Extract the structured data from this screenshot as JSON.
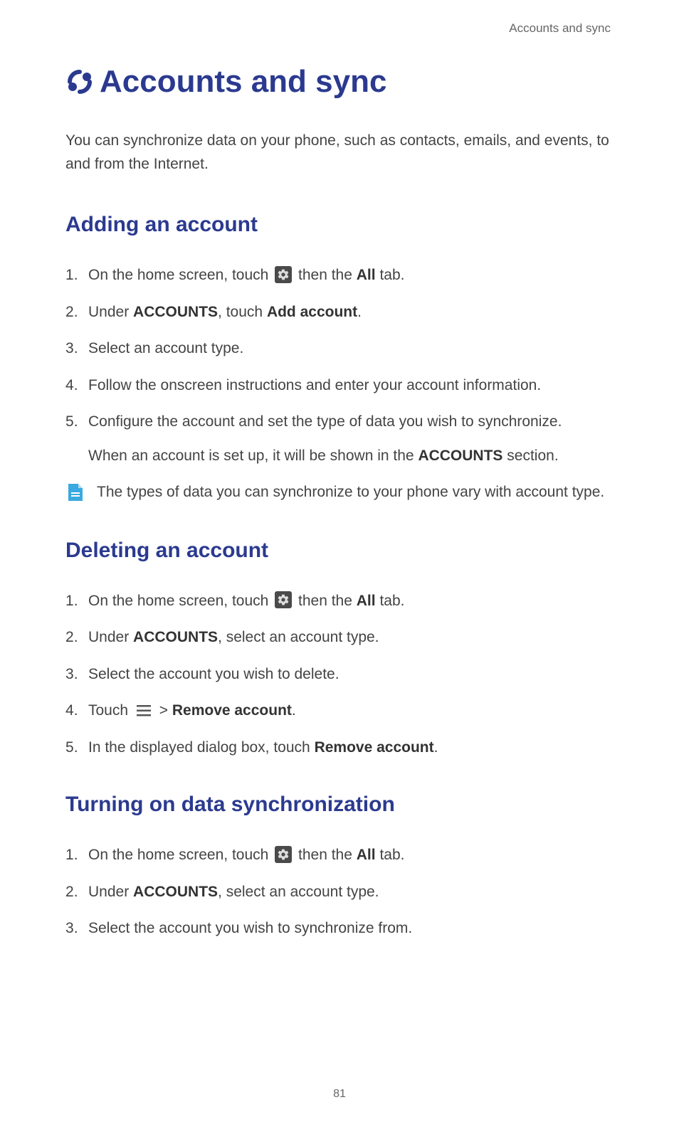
{
  "header": {
    "label": "Accounts and sync"
  },
  "title": "Accounts and sync",
  "intro": "You can synchronize data on your phone, such as contacts, emails, and events, to and from the Internet.",
  "sections": {
    "adding": {
      "heading": "Adding an account",
      "step1_a": "On the home screen, touch",
      "step1_b": "then the",
      "step1_bold": "All",
      "step1_c": "tab.",
      "step2_a": "Under",
      "step2_bold1": "ACCOUNTS",
      "step2_b": ", touch",
      "step2_bold2": "Add account",
      "step2_c": ".",
      "step3": "Select an account type.",
      "step4": "Follow the onscreen instructions and enter your account information.",
      "step5_a": "Configure the account and set the type of data you wish to synchronize.",
      "step5_b_a": "When an account is set up, it will be shown in the",
      "step5_b_bold": "ACCOUNTS",
      "step5_b_b": "section.",
      "note": "The types of data you can synchronize to your phone vary with account type."
    },
    "deleting": {
      "heading": "Deleting an account",
      "step1_a": "On the home screen, touch",
      "step1_b": "then the",
      "step1_bold": "All",
      "step1_c": "tab.",
      "step2_a": "Under",
      "step2_bold": "ACCOUNTS",
      "step2_b": ", select an account type.",
      "step3": "Select the account you wish to delete.",
      "step4_a": "Touch",
      "step4_b": ">",
      "step4_bold": "Remove account",
      "step4_c": ".",
      "step5_a": "In the displayed dialog box, touch",
      "step5_bold": "Remove account",
      "step5_b": "."
    },
    "turning": {
      "heading": "Turning on data synchronization",
      "step1_a": "On the home screen, touch",
      "step1_b": "then the",
      "step1_bold": "All",
      "step1_c": "tab.",
      "step2_a": "Under",
      "step2_bold": "ACCOUNTS",
      "step2_b": ", select an account type.",
      "step3": "Select the account you wish to synchronize from."
    }
  },
  "pageNumber": "81"
}
